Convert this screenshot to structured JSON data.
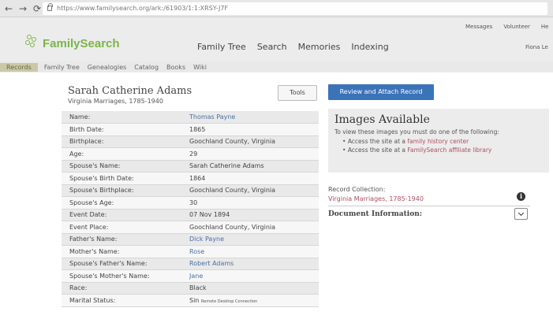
{
  "browser": {
    "url": "https://www.familysearch.org/ark:/61903/1:1:XRSY-J7F"
  },
  "header": {
    "logo_text": "FamilySearch",
    "nav": [
      "Family Tree",
      "Search",
      "Memories",
      "Indexing"
    ],
    "top_links": [
      "Messages",
      "Volunteer",
      "He"
    ],
    "user": "Fiona Le"
  },
  "subnav": [
    "Records",
    "Family Tree",
    "Genealogies",
    "Catalog",
    "Books",
    "Wiki"
  ],
  "record": {
    "name": "Sarah Catherine Adams",
    "collection": "Virginia Marriages, 1785-1940",
    "tools_label": "Tools",
    "fields": [
      {
        "label": "Name:",
        "value": "Thomas Payne",
        "link": true
      },
      {
        "label": "Birth Date:",
        "value": "1865",
        "link": false
      },
      {
        "label": "Birthplace:",
        "value": "Goochland County, Virginia",
        "link": false
      },
      {
        "label": "Age:",
        "value": "29",
        "link": false
      },
      {
        "label": "Spouse's Name:",
        "value": "Sarah Catherine Adams",
        "link": false
      },
      {
        "label": "Spouse's Birth Date:",
        "value": "1864",
        "link": false
      },
      {
        "label": "Spouse's Birthplace:",
        "value": "Goochland County, Virginia",
        "link": false
      },
      {
        "label": "Spouse's Age:",
        "value": "30",
        "link": false
      },
      {
        "label": "Event Date:",
        "value": "07 Nov 1894",
        "link": false
      },
      {
        "label": "Event Place:",
        "value": "Goochland County, Virginia",
        "link": false
      },
      {
        "label": "Father's Name:",
        "value": "Dick Payne",
        "link": true
      },
      {
        "label": "Mother's Name:",
        "value": "Rose",
        "link": true
      },
      {
        "label": "Spouse's Father's Name:",
        "value": "Robert Adams",
        "link": true
      },
      {
        "label": "Spouse's Mother's Name:",
        "value": "Jane",
        "link": true
      },
      {
        "label": "Race:",
        "value": "Black",
        "link": false
      },
      {
        "label": "Marital Status:",
        "value": "Sin",
        "link": false,
        "note": "Remote Desktop Connection"
      }
    ]
  },
  "sidebar": {
    "review_label": "Review and Attach Record",
    "images_title": "Images Available",
    "images_desc": "To view these images you must do one of the following:",
    "images_options": [
      {
        "prefix": "Access the site at a ",
        "link": "family history center"
      },
      {
        "prefix": "Access the site at a ",
        "link": "FamilySearch affiliate library"
      }
    ],
    "collection_label": "Record Collection:",
    "collection_link": "Virginia Marriages, 1785-1940",
    "doc_info": "Document Information:"
  }
}
